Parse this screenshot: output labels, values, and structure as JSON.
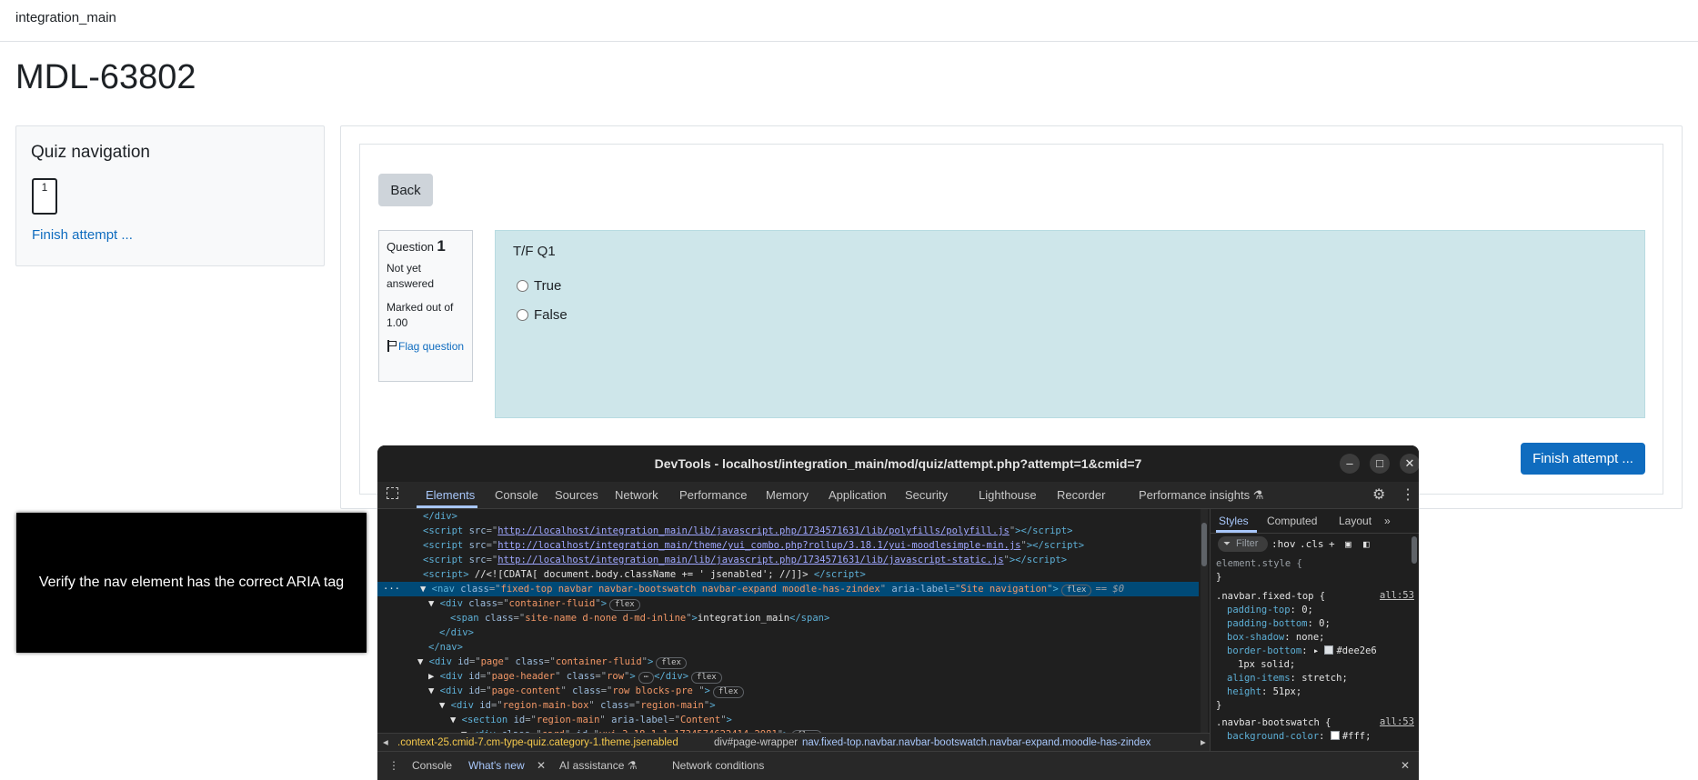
{
  "navbar": {
    "site_name": "integration_main"
  },
  "page": {
    "title": "MDL-63802"
  },
  "quiz_nav": {
    "title": "Quiz navigation",
    "question_button": "1",
    "finish_link": "Finish attempt ..."
  },
  "main": {
    "back_label": "Back",
    "question": {
      "label": "Question",
      "number": "1",
      "state": "Not yet answered",
      "grade": "Marked out of 1.00",
      "flag": "Flag question",
      "text": "T/F Q1",
      "answers": [
        "True",
        "False"
      ]
    },
    "finish_button": "Finish attempt ..."
  },
  "overlay": {
    "text": "Verify the nav element has the correct ARIA tag"
  },
  "devtools": {
    "title": "DevTools - localhost/integration_main/mod/quiz/attempt.php?attempt=1&cmid=7",
    "window_buttons": [
      "–",
      "□",
      "✕"
    ],
    "tabs": [
      "Elements",
      "Console",
      "Sources",
      "Network",
      "Performance",
      "Memory",
      "Application",
      "Security",
      "Lighthouse",
      "Recorder",
      "Performance insights ⚗",
      "»"
    ],
    "active_tab": "Elements",
    "dom": {
      "l0": "</div>",
      "l1_src": "http://localhost/integration_main/lib/javascript.php/1734571631/lib/polyfills/polyfill.js",
      "l2_src": "http://localhost/integration_main/theme/yui_combo.php?rollup/3.18.1/yui-moodlesimple-min.js",
      "l3_src": "http://localhost/integration_main/lib/javascript.php/1734571631/lib/javascript-static.js",
      "l4_text": "//<![CDATA[ document.body.className += ' jsenabled'; //]]>",
      "l5_class": "fixed-top navbar navbar-bootswatch navbar-expand moodle-has-zindex",
      "l5_aria": "Site navigation",
      "l5_dollar": "== $0",
      "l6_class": "container-fluid",
      "l7_class": "site-name d-none d-md-inline",
      "l7_text": "integration_main",
      "l10_id": "page",
      "l10_class": "container-fluid",
      "l11_id": "page-header",
      "l11_class": "row",
      "l12_id": "page-content",
      "l12_class": "row  blocks-pre  ",
      "l13_id": "region-main-box",
      "l13_class": "region-main",
      "l14_id": "region-main",
      "l14_aria": "Content",
      "l15_class": "card",
      "l15_id": "yui_3_18_1_1_1734574622414_2981",
      "flex": "flex",
      "ellipsis": "⋯"
    },
    "breadcrumbs": [
      ".context-25.cmid-7.cm-type-quiz.category-1.theme.jsenabled",
      "div#page-wrapper",
      "nav.fixed-top.navbar.navbar-bootswatch.navbar-expand.moodle-has-zindex"
    ],
    "styles": {
      "tabs": [
        "Styles",
        "Computed",
        "Layout",
        "»"
      ],
      "filter_placeholder": "Filter",
      "hov": ":hov",
      "cls": ".cls",
      "element_style": "element.style {",
      "close_brace": "}",
      "rule1_selector": ".navbar.fixed-top {",
      "rule1_source": "all:53",
      "rule1_props": [
        {
          "name": "padding-top",
          "value": "0;"
        },
        {
          "name": "padding-bottom",
          "value": "0;"
        },
        {
          "name": "box-shadow",
          "value": "none;"
        },
        {
          "name": "border-bottom",
          "value": "#dee2e6"
        },
        {
          "name": "",
          "value": "1px solid;"
        },
        {
          "name": "align-items",
          "value": "stretch;"
        },
        {
          "name": "height",
          "value": "51px;"
        }
      ],
      "rule2_selector": ".navbar-bootswatch {",
      "rule2_source": "all:53",
      "rule2_prop": {
        "name": "background-color",
        "value": "#fff;"
      }
    },
    "drawer": [
      "Console",
      "What's new",
      "AI assistance ⚗",
      "Network conditions"
    ],
    "drawer_active": "What's new"
  }
}
